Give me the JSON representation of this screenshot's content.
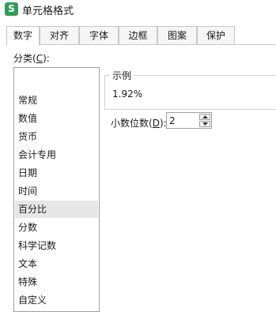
{
  "window": {
    "title": "单元格格式",
    "app_icon_letter": "S",
    "accent_color": "#2e9e54"
  },
  "tabs": [
    {
      "label": "数字",
      "active": true
    },
    {
      "label": "对齐",
      "active": false
    },
    {
      "label": "字体",
      "active": false
    },
    {
      "label": "边框",
      "active": false
    },
    {
      "label": "图案",
      "active": false
    },
    {
      "label": "保护",
      "active": false
    }
  ],
  "category": {
    "label_prefix": "分类(",
    "label_key": "C",
    "label_suffix": "):",
    "items": [
      "常规",
      "数值",
      "货币",
      "会计专用",
      "日期",
      "时间",
      "百分比",
      "分数",
      "科学记数",
      "文本",
      "特殊",
      "自定义"
    ],
    "selected": "百分比"
  },
  "sample": {
    "title": "示例",
    "value": "1.92%"
  },
  "decimal_places": {
    "label_prefix": "小数位数(",
    "label_key": "D",
    "label_suffix": "):",
    "value": "2"
  }
}
